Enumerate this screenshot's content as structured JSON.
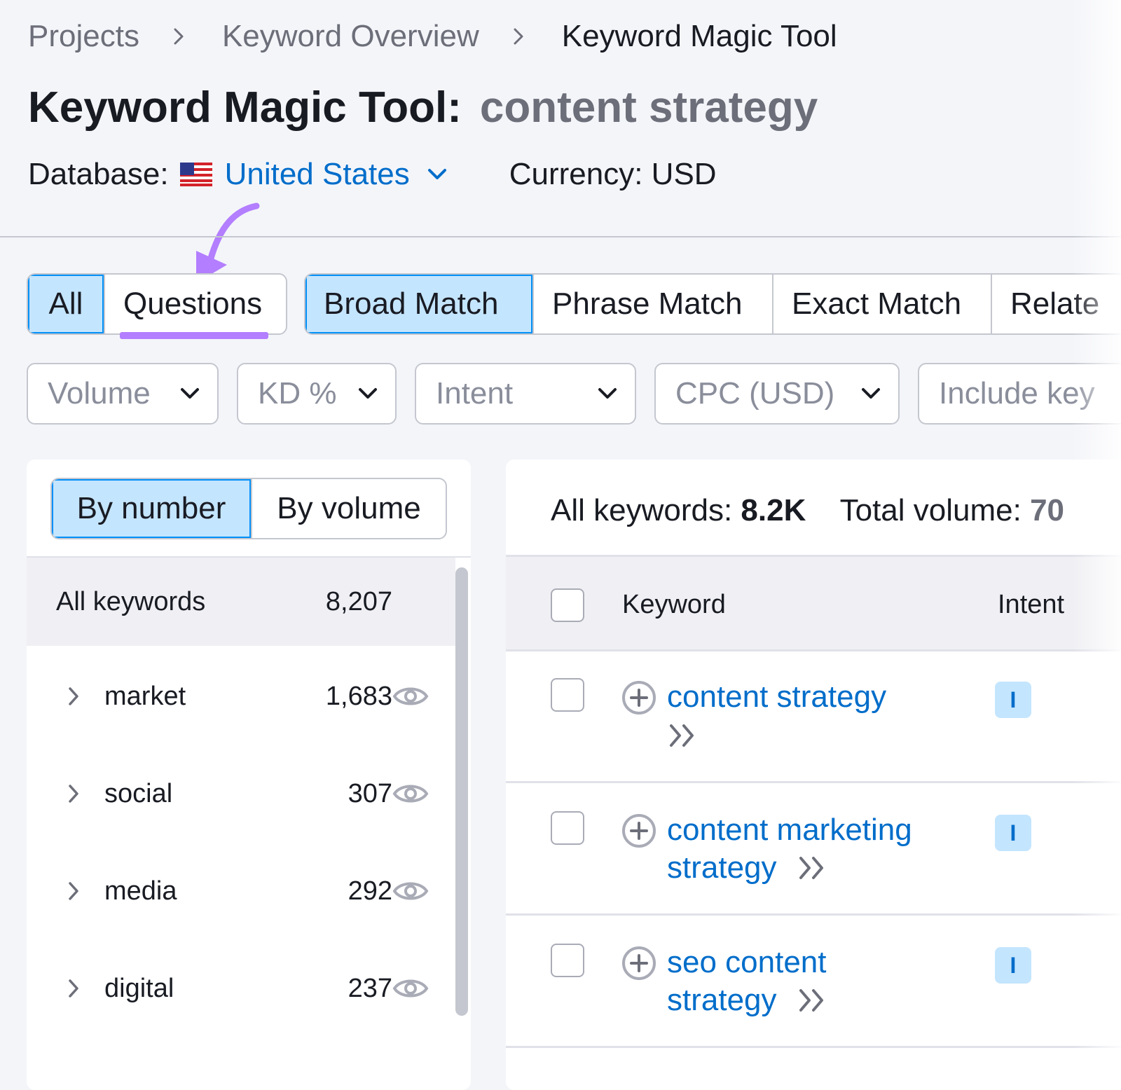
{
  "breadcrumb": {
    "items": [
      "Projects",
      "Keyword Overview",
      "Keyword Magic Tool"
    ]
  },
  "page": {
    "title_prefix": "Keyword Magic Tool:",
    "keyword": "content strategy"
  },
  "database": {
    "label": "Database:",
    "country": "United States",
    "currency": "Currency: USD"
  },
  "tabs": {
    "type": [
      "All",
      "Questions"
    ],
    "match": [
      "Broad Match",
      "Phrase Match",
      "Exact Match",
      "Relate"
    ]
  },
  "filters": [
    "Volume",
    "KD %",
    "Intent",
    "CPC (USD)",
    "Include key"
  ],
  "groups": {
    "sort": [
      "By number",
      "By volume"
    ],
    "all": {
      "label": "All keywords",
      "count": "8,207"
    },
    "items": [
      {
        "label": "market",
        "count": "1,683"
      },
      {
        "label": "social",
        "count": "307"
      },
      {
        "label": "media",
        "count": "292"
      },
      {
        "label": "digital",
        "count": "237"
      }
    ]
  },
  "summary": {
    "all_label": "All keywords:",
    "all_value": "8.2K",
    "total_label": "Total volume:",
    "total_value": "70"
  },
  "table": {
    "headers": {
      "keyword": "Keyword",
      "intent": "Intent"
    },
    "rows": [
      {
        "line1": "content strategy",
        "line2": "",
        "intent": "I"
      },
      {
        "line1": "content marketing",
        "line2": "strategy",
        "intent": "I"
      },
      {
        "line1": "seo content",
        "line2": "strategy",
        "intent": "I"
      }
    ]
  },
  "colors": {
    "accent": "#006dca",
    "active_bg": "#c4e5fe",
    "annotation": "#b37eff"
  }
}
